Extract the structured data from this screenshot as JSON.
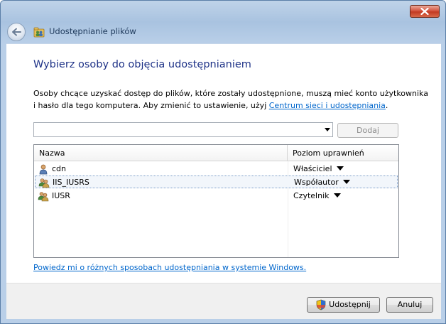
{
  "window": {
    "title": "Udostępnianie plików"
  },
  "content": {
    "heading": "Wybierz osoby do objęcia udostępnianiem",
    "description_text": "Osoby chcące uzyskać dostęp do plików, które zostały udostępnione, muszą mieć konto użytkownika i hasło dla tego komputera. Aby zmienić to ustawienie, użyj ",
    "description_link": "Centrum sieci i udostępniania",
    "description_end": ".",
    "combo_value": "",
    "add_button": "Dodaj",
    "list": {
      "columns": [
        "Nazwa",
        "Poziom uprawnień"
      ],
      "rows": [
        {
          "name": "cdn",
          "permission": "Właściciel",
          "icon": "user-icon"
        },
        {
          "name": "IIS_IUSRS",
          "permission": "Współautor",
          "icon": "group-icon"
        },
        {
          "name": "IUSR",
          "permission": "Czytelnik",
          "icon": "group-icon"
        }
      ]
    },
    "help_link": "Powiedz mi o różnych sposobach udostępniania w systemie Windows."
  },
  "footer": {
    "share_button": "Udostępnij",
    "cancel_button": "Anuluj"
  },
  "colors": {
    "heading": "#1e3287",
    "link": "#0066cc"
  }
}
